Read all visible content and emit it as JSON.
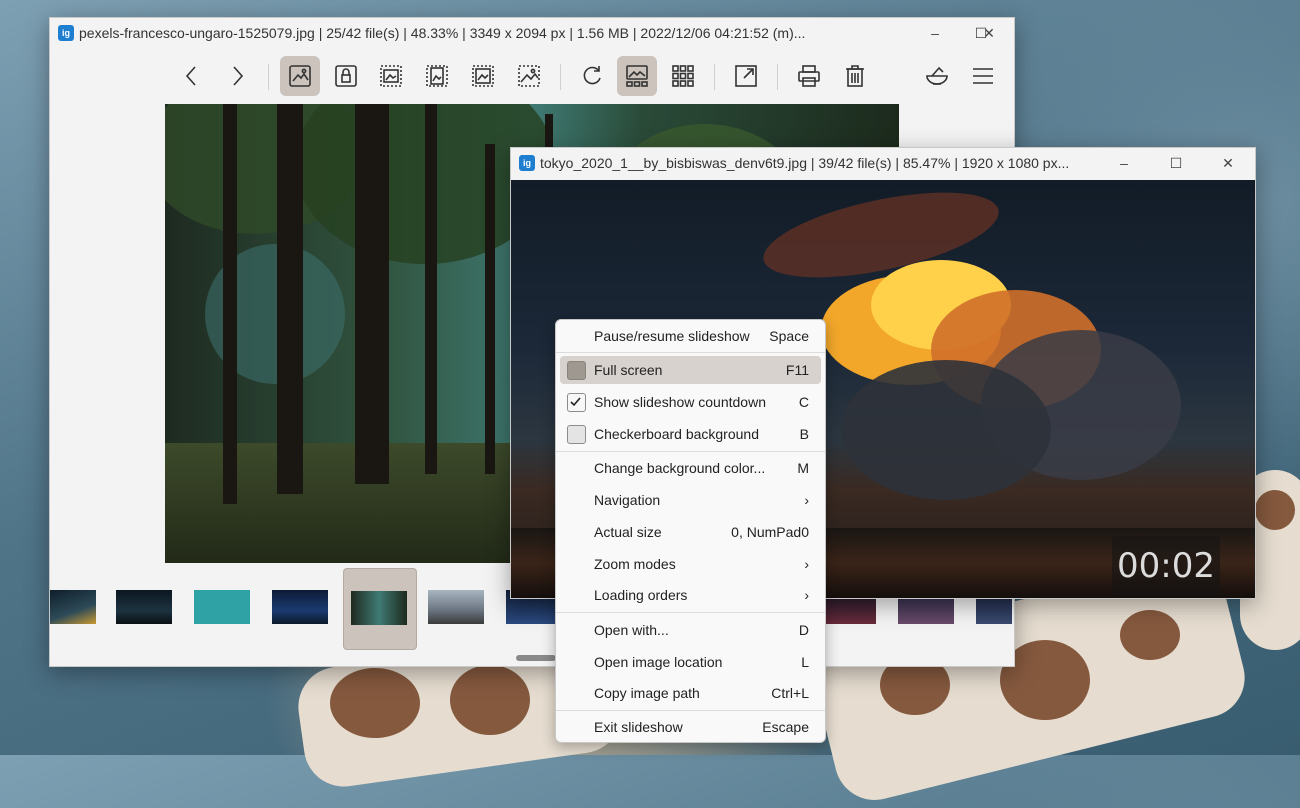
{
  "main_window": {
    "title": "pexels-francesco-ungaro-1525079.jpg  |  25/42 file(s)  |  48.33%  |  3349 x 2094 px  |  1.56 MB  |  2022/12/06 04:21:52 (m)...",
    "app_icon_text": "ig",
    "toolbar": [
      {
        "name": "previous-image",
        "icon": "chevron-left-icon"
      },
      {
        "name": "next-image",
        "icon": "chevron-right-icon"
      },
      {
        "name": "auto-zoom",
        "icon": "picture-icon",
        "active": true
      },
      {
        "name": "lock-zoom",
        "icon": "lock-icon"
      },
      {
        "name": "scale-to-width",
        "icon": "scale-width-icon"
      },
      {
        "name": "scale-to-height",
        "icon": "scale-height-icon"
      },
      {
        "name": "scale-to-fit",
        "icon": "scale-fit-icon"
      },
      {
        "name": "scale-to-fill",
        "icon": "scale-fill-icon"
      },
      {
        "name": "refresh",
        "icon": "refresh-icon"
      },
      {
        "name": "thumbnail-bar",
        "icon": "thumbnail-bar-icon",
        "active": true
      },
      {
        "name": "gallery",
        "icon": "grid-icon"
      },
      {
        "name": "fullscreen",
        "icon": "expand-icon"
      },
      {
        "name": "print",
        "icon": "printer-icon"
      },
      {
        "name": "delete",
        "icon": "trash-icon"
      },
      {
        "name": "edit",
        "icon": "edit-bowl-icon"
      },
      {
        "name": "main-menu",
        "icon": "hamburger-icon"
      }
    ]
  },
  "slideshow_window": {
    "title": "tokyo_2020_1__by_bisbiswas_denv6t9.jpg  |  39/42 file(s)  |  85.47%  |  1920 x 1080 px...",
    "app_icon_text": "ig",
    "countdown": "00:02"
  },
  "window_controls": {
    "minimize": "–",
    "maximize": "☐",
    "close": "✕"
  },
  "context_menu": {
    "items": [
      {
        "label": "Pause/resume slideshow",
        "shortcut": "Space"
      },
      {
        "label": "Full screen",
        "shortcut": "F11",
        "checkbox": false,
        "highlighted": true
      },
      {
        "label": "Show slideshow countdown",
        "shortcut": "C",
        "checkbox": true
      },
      {
        "label": "Checkerboard background",
        "shortcut": "B",
        "checkbox": false
      },
      {
        "label": "Change background color...",
        "shortcut": "M"
      },
      {
        "label": "Navigation",
        "shortcut": "›"
      },
      {
        "label": "Actual size",
        "shortcut": "0, NumPad0"
      },
      {
        "label": "Zoom modes",
        "shortcut": "›"
      },
      {
        "label": "Loading orders",
        "shortcut": "›"
      },
      {
        "label": "Open with...",
        "shortcut": "D"
      },
      {
        "label": "Open image location",
        "shortcut": "L"
      },
      {
        "label": "Copy image path",
        "shortcut": "Ctrl+L"
      },
      {
        "label": "Exit slideshow",
        "shortcut": "Escape"
      }
    ]
  },
  "colors": {
    "accent_selection": "#cbc3bc",
    "app_icon": "#1e7fd1",
    "menu_highlight": "#d7d2cd"
  }
}
